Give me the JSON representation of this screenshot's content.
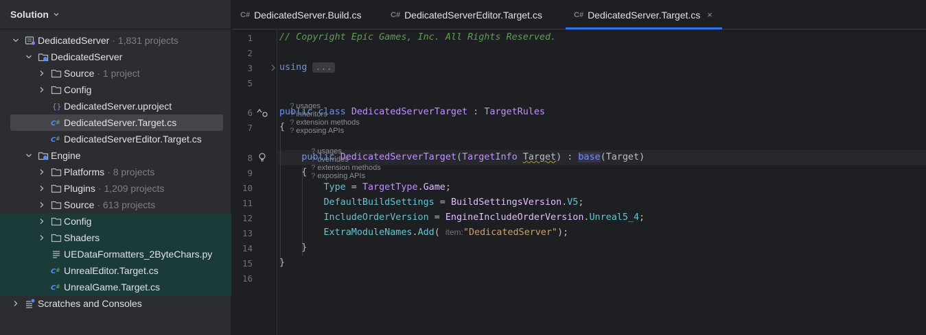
{
  "sidebar": {
    "title": "Solution",
    "tree": [
      {
        "label": "DedicatedServer",
        "meta": "1,831 projects",
        "depth": 0,
        "expanded": true,
        "icon": "solution-icon"
      },
      {
        "label": "DedicatedServer",
        "meta": "",
        "depth": 1,
        "expanded": true,
        "icon": "project-icon"
      },
      {
        "label": "Source",
        "meta": "1 project",
        "depth": 2,
        "expanded": false,
        "icon": "folder-icon"
      },
      {
        "label": "Config",
        "meta": "",
        "depth": 2,
        "expanded": false,
        "icon": "folder-icon"
      },
      {
        "label": "DedicatedServer.uproject",
        "meta": "",
        "depth": 2,
        "icon": "uproject-icon"
      },
      {
        "label": "DedicatedServer.Target.cs",
        "meta": "",
        "depth": 2,
        "icon": "csharp-file-icon",
        "selected": true
      },
      {
        "label": "DedicatedServerEditor.Target.cs",
        "meta": "",
        "depth": 2,
        "icon": "csharp-file-icon"
      },
      {
        "label": "Engine",
        "meta": "",
        "depth": 1,
        "expanded": true,
        "icon": "project-icon"
      },
      {
        "label": "Platforms",
        "meta": "8 projects",
        "depth": 2,
        "expanded": false,
        "icon": "folder-icon"
      },
      {
        "label": "Plugins",
        "meta": "1,209 projects",
        "depth": 2,
        "expanded": false,
        "icon": "folder-icon"
      },
      {
        "label": "Source",
        "meta": "613 projects",
        "depth": 2,
        "expanded": false,
        "icon": "folder-icon"
      },
      {
        "label": "Config",
        "meta": "",
        "depth": 2,
        "expanded": false,
        "icon": "folder-icon",
        "teal": true
      },
      {
        "label": "Shaders",
        "meta": "",
        "depth": 2,
        "expanded": false,
        "icon": "folder-icon",
        "teal": true
      },
      {
        "label": "UEDataFormatters_2ByteChars.py",
        "meta": "",
        "depth": 2,
        "icon": "text-file-icon",
        "teal": true
      },
      {
        "label": "UnrealEditor.Target.cs",
        "meta": "",
        "depth": 2,
        "icon": "csharp-file-icon",
        "teal": true
      },
      {
        "label": "UnrealGame.Target.cs",
        "meta": "",
        "depth": 2,
        "icon": "csharp-file-icon",
        "teal": true
      },
      {
        "label": "Scratches and Consoles",
        "meta": "",
        "depth": 0,
        "expanded": false,
        "icon": "scratches-icon"
      }
    ]
  },
  "tabs": [
    {
      "badge": "C#",
      "label": "DedicatedServer.Build.cs",
      "active": false
    },
    {
      "badge": "C#",
      "label": "DedicatedServerEditor.Target.cs",
      "active": false
    },
    {
      "badge": "C#",
      "label": "DedicatedServer.Target.cs",
      "active": true,
      "close": "×"
    }
  ],
  "editor": {
    "line_numbers": [
      "1",
      "2",
      "3",
      "5",
      "6",
      "7",
      "8",
      "9",
      "10",
      "11",
      "12",
      "13",
      "14",
      "15",
      "16"
    ],
    "comment": "// Copyright Epic Games, Inc. All Rights Reserved.",
    "using_kw": "using",
    "using_fold": "...",
    "hints_class": [
      "usages",
      "inheritors",
      "extension methods",
      "exposing APIs"
    ],
    "hints_ctor": [
      "usages",
      "overrides",
      "extension methods",
      "exposing APIs"
    ],
    "hint_mark": "?",
    "kw_public": "public",
    "kw_class": "class",
    "class_name": "DedicatedServerTarget",
    "colon": " : ",
    "base_type": "TargetRules",
    "brace_open": "{",
    "brace_close": "}",
    "ctor_name": "DedicatedServerTarget",
    "param_type": "TargetInfo",
    "param_name": "Target",
    "kw_base": "base",
    "base_arg": "Target",
    "prop_type": "Type",
    "enum_type": "TargetType",
    "enum_game": "Game",
    "prop_dbs": "DefaultBuildSettings",
    "enum_bsv": "BuildSettingsVersion",
    "enum_v5": "V5",
    "prop_iov": "IncludeOrderVersion",
    "enum_eiov": "EngineIncludeOrderVersion",
    "enum_u54": "Unreal5_4",
    "prop_emn": "ExtraModuleNames",
    "method_add": "Add",
    "inlay_item": "item:",
    "string_value": "\"DedicatedServer\""
  }
}
